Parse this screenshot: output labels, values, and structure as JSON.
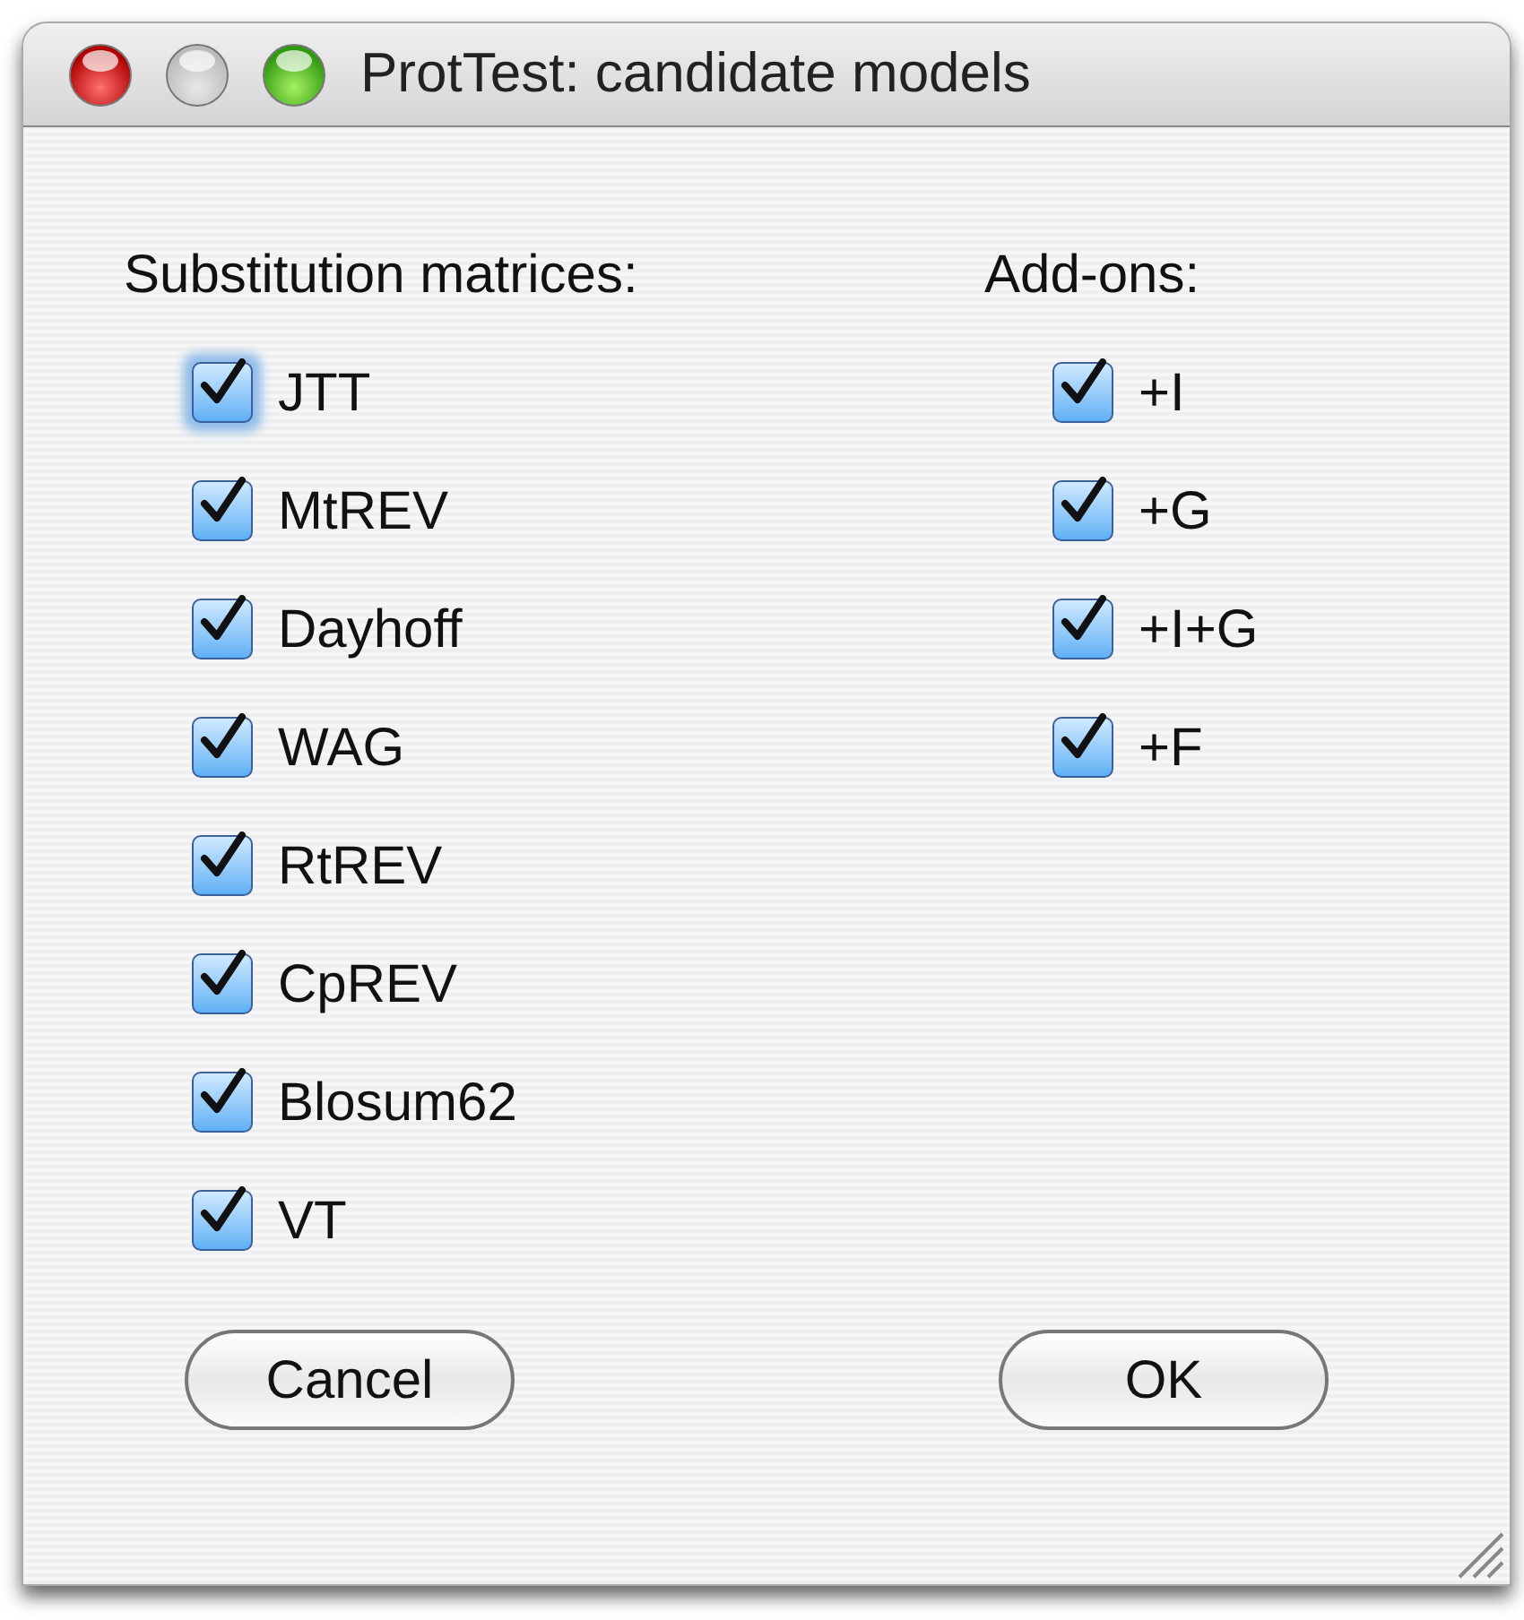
{
  "window": {
    "title": "ProtTest: candidate models"
  },
  "substitution_matrices": {
    "heading": "Substitution matrices:",
    "items": [
      {
        "label": "JTT",
        "checked": true,
        "focused": true
      },
      {
        "label": "MtREV",
        "checked": true,
        "focused": false
      },
      {
        "label": "Dayhoff",
        "checked": true,
        "focused": false
      },
      {
        "label": "WAG",
        "checked": true,
        "focused": false
      },
      {
        "label": "RtREV",
        "checked": true,
        "focused": false
      },
      {
        "label": "CpREV",
        "checked": true,
        "focused": false
      },
      {
        "label": "Blosum62",
        "checked": true,
        "focused": false
      },
      {
        "label": "VT",
        "checked": true,
        "focused": false
      }
    ]
  },
  "add_ons": {
    "heading": "Add-ons:",
    "items": [
      {
        "label": "+I",
        "checked": true,
        "focused": false
      },
      {
        "label": "+G",
        "checked": true,
        "focused": false
      },
      {
        "label": "+I+G",
        "checked": true,
        "focused": false
      },
      {
        "label": "+F",
        "checked": true,
        "focused": false
      }
    ]
  },
  "buttons": [
    "Cancel",
    "OK"
  ]
}
